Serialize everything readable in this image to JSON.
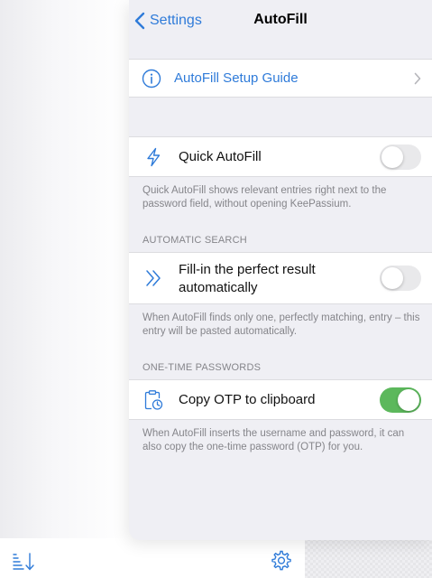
{
  "nav": {
    "back_label": "Settings",
    "title": "AutoFill"
  },
  "setup_guide": {
    "label": "AutoFill Setup Guide",
    "icon": "info-icon"
  },
  "quick_autofill": {
    "label": "Quick AutoFill",
    "enabled": false,
    "icon": "bolt-icon",
    "footer": "Quick AutoFill shows relevant entries right next to the password field, without opening KeePassium."
  },
  "automatic_search": {
    "header": "AUTOMATIC SEARCH",
    "label": "Fill-in the perfect result automatically",
    "enabled": false,
    "icon": "double-chevron-icon",
    "footer": "When AutoFill finds only one, perfectly matching, entry – this entry will be pasted automatically."
  },
  "otp": {
    "header": "ONE-TIME PASSWORDS",
    "label": "Copy OTP to clipboard",
    "enabled": true,
    "icon": "clipboard-clock-icon",
    "footer": "When AutoFill inserts the username and password, it can also copy the one-time password (OTP) for you."
  },
  "bottom_bar": {
    "sort_icon": "sort-icon",
    "settings_icon": "gear-icon"
  },
  "colors": {
    "accent": "#2f7bd9",
    "toggle_on": "#5cb85c",
    "group_background": "#efeff4"
  }
}
